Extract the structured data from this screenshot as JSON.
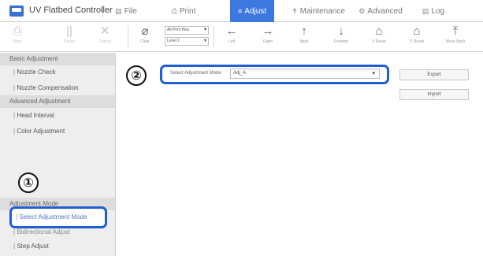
{
  "app": {
    "title": "UV Flatbed Controller"
  },
  "menu": [
    {
      "label": "File",
      "glyph": "▤",
      "active": false
    },
    {
      "label": "Print",
      "glyph": "⎙",
      "active": false
    },
    {
      "label": "Adjust",
      "glyph": "≡",
      "active": true
    },
    {
      "label": "Maintenance",
      "glyph": "✝",
      "active": false
    },
    {
      "label": "Advanced",
      "glyph": "⚙",
      "active": false
    },
    {
      "label": "Log",
      "glyph": "▤",
      "active": false
    }
  ],
  "toolbar": {
    "print_label": "Print",
    "pause_label": "Pause",
    "cancel_label": "Cancel",
    "clear_label": "Clear",
    "print_head_select": "All Print Hea",
    "level_select": "Level 1",
    "left_label": "Left",
    "right_label": "Right",
    "back_label": "Back",
    "forward_label": "Forward",
    "xreset_label": "X Reset",
    "yreset_label": "Y Reset",
    "moveback_label": "Move Back"
  },
  "sidebar": {
    "sections": [
      {
        "header": "Basic Adjustment",
        "items": [
          "Nozzle Check",
          "Nozzle Compensation"
        ]
      },
      {
        "header": "Advanced Adjustment",
        "items": [
          "Head Interval",
          "Color Adjustment"
        ]
      },
      {
        "header": "Adjustment Mode",
        "items": [
          "Select Adjustment Mode",
          "Bidirectional Adjust",
          "Step Adjust"
        ]
      }
    ],
    "selected": "Select Adjustment Mode"
  },
  "main": {
    "mode_label": "Select Adjustment Mode",
    "mode_value": "Adj_A",
    "export_label": "Export",
    "import_label": "Import"
  },
  "badges": {
    "step1": "①",
    "step2": "②"
  },
  "colors": {
    "accent": "#3d77e0",
    "highlight": "#1f5fd6",
    "sidebar_bg": "#eeeeee"
  }
}
